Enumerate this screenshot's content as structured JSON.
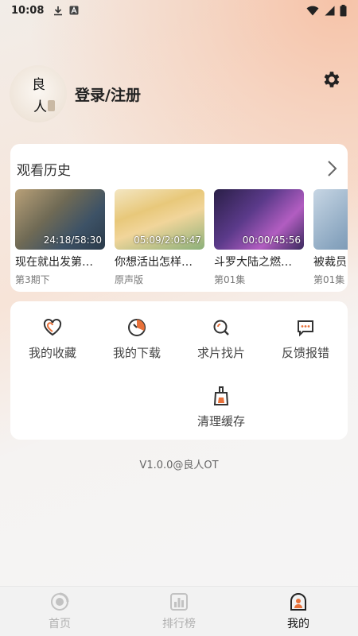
{
  "status_bar": {
    "time": "10:08"
  },
  "profile": {
    "avatar_chars": [
      "良",
      "人"
    ],
    "login_label": "登录/注册"
  },
  "history": {
    "title": "观看历史",
    "items": [
      {
        "time": "24:18/58:30",
        "title": "现在就出发第…",
        "sub": "第3期下"
      },
      {
        "time": "05:09/2:03:47",
        "title": "你想活出怎样…",
        "sub": "原声版"
      },
      {
        "time": "00:00/45:56",
        "title": "斗罗大陆之燃…",
        "sub": "第01集"
      },
      {
        "time": "",
        "title": "被裁员",
        "sub": "第01集"
      }
    ]
  },
  "menu": {
    "items": [
      {
        "label": "我的收藏",
        "icon": "heart-icon"
      },
      {
        "label": "我的下载",
        "icon": "download-icon"
      },
      {
        "label": "求片找片",
        "icon": "search-film-icon"
      },
      {
        "label": "反馈报错",
        "icon": "feedback-icon"
      },
      {
        "label": "清理缓存",
        "icon": "broom-icon"
      }
    ]
  },
  "version": "V1.0.0@良人OT",
  "bottom_nav": {
    "items": [
      {
        "label": "首页",
        "icon": "home-icon",
        "active": false
      },
      {
        "label": "排行榜",
        "icon": "ranking-icon",
        "active": false
      },
      {
        "label": "我的",
        "icon": "profile-icon",
        "active": true
      }
    ]
  },
  "colors": {
    "accent": "#e8713a",
    "card": "#ffffff",
    "active_nav": "#111111",
    "inactive_nav": "#b0b0b0"
  }
}
